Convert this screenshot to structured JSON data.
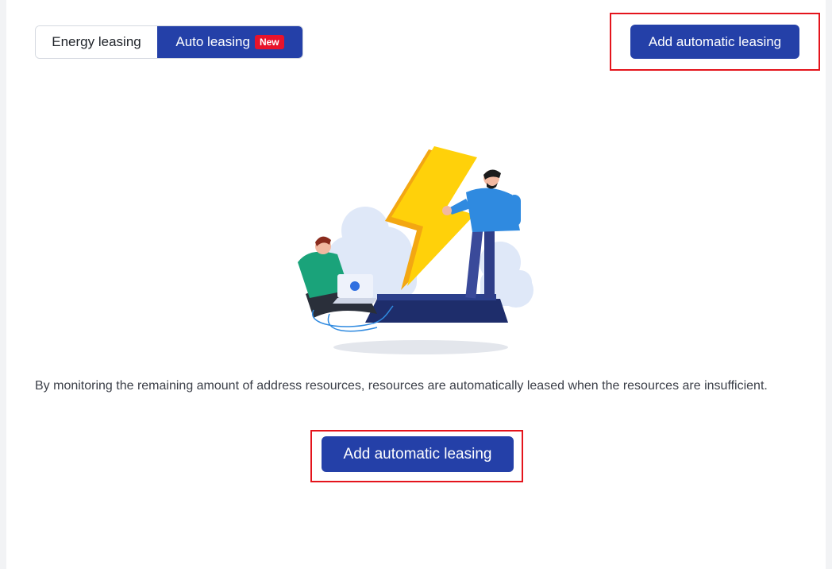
{
  "tabs": {
    "energy_label": "Energy leasing",
    "auto_label": "Auto leasing",
    "new_badge": "New"
  },
  "header": {
    "add_button_label": "Add automatic leasing"
  },
  "empty_state": {
    "description": "By monitoring the remaining amount of address resources, resources are automatically leased when the resources are insufficient.",
    "add_button_label": "Add automatic leasing"
  },
  "colors": {
    "primary": "#2440a8",
    "badge": "#e8132b",
    "highlight": "#e4141c"
  }
}
